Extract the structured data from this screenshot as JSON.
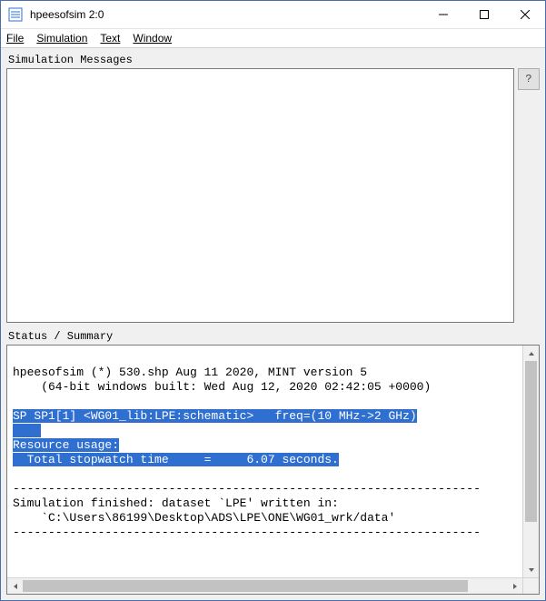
{
  "window": {
    "title": "hpeesofsim 2:0"
  },
  "menubar": {
    "file": "File",
    "simulation": "Simulation",
    "text": "Text",
    "window": "Window"
  },
  "labels": {
    "simulation_messages": "Simulation Messages",
    "status_summary": "Status / Summary",
    "help": "?"
  },
  "status": {
    "line1": "hpeesofsim (*) 530.shp Aug 11 2020, MINT version 5",
    "line2": "    (64-bit windows built: Wed Aug 12, 2020 02:42:05 +0000)",
    "hl1": "SP SP1[1] <WG01_lib:LPE:schematic>   freq=(10 MHz->2 GHz)",
    "hl2": "    ",
    "hl3": "Resource usage:",
    "hl4": "  Total stopwatch time     =     6.07 seconds.",
    "sep": "------------------------------------------------------------------",
    "fin1": "Simulation finished: dataset `LPE' written in:",
    "fin2": "    `C:\\Users\\86199\\Desktop\\ADS\\LPE\\ONE\\WG01_wrk/data'"
  }
}
